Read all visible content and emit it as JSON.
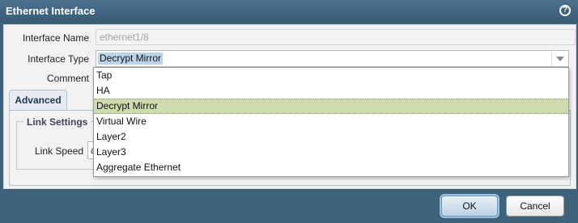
{
  "dialog": {
    "title": "Ethernet Interface",
    "help_symbol": "?"
  },
  "form": {
    "interface_name_label": "Interface Name",
    "interface_name_value": "ethernet1/8",
    "interface_type_label": "Interface Type",
    "interface_type_value": "Decrypt Mirror",
    "comment_label": "Comment"
  },
  "tabs": [
    {
      "label": "Advanced"
    }
  ],
  "link_settings": {
    "legend": "Link Settings",
    "link_speed_label": "Link Speed",
    "link_speed_value": "au"
  },
  "dropdown": {
    "options": [
      "Tap",
      "HA",
      "Decrypt Mirror",
      "Virtual Wire",
      "Layer2",
      "Layer3",
      "Aggregate Ethernet"
    ],
    "selected": "Decrypt Mirror"
  },
  "buttons": {
    "ok": "OK",
    "cancel": "Cancel"
  },
  "colors": {
    "titlebar": "#3f627b",
    "highlight": "#cfdcb0",
    "selection": "#bcd3ec"
  }
}
